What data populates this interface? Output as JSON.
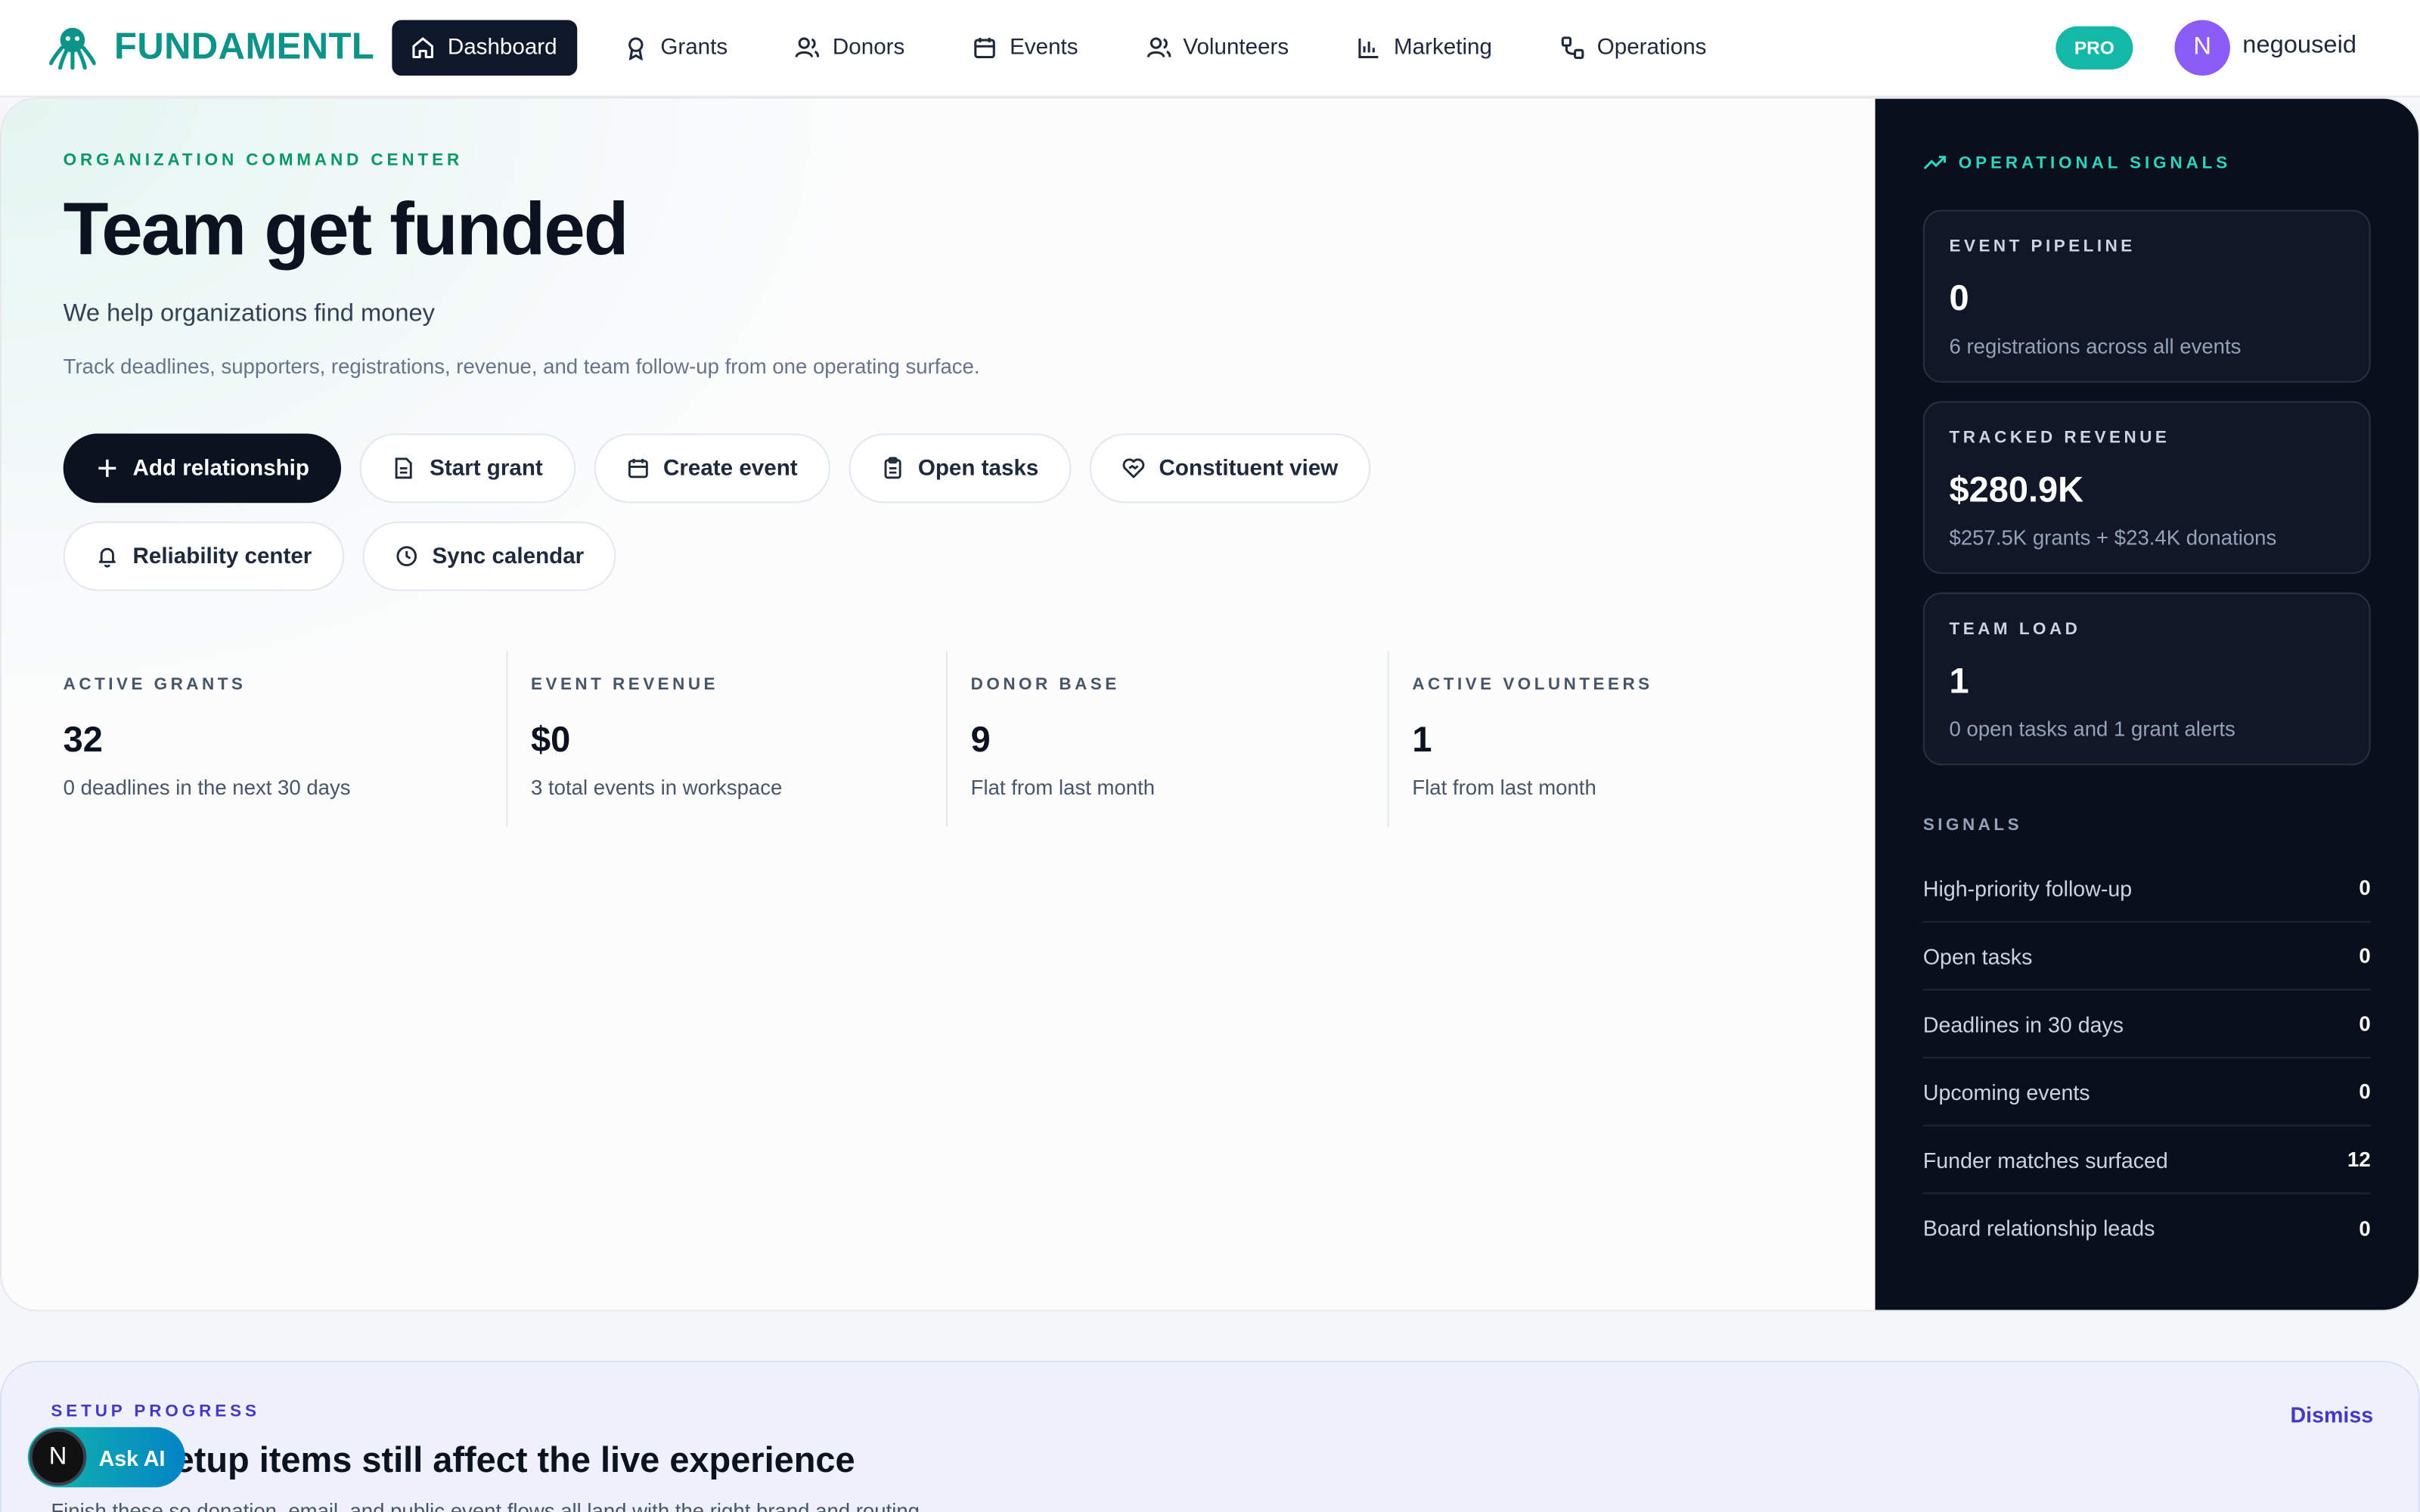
{
  "brand": {
    "name": "FUNDAMENTL",
    "logo_icon": "octopus-icon"
  },
  "nav": {
    "items": [
      {
        "label": "Dashboard",
        "icon": "home-icon",
        "active": true
      },
      {
        "label": "Grants",
        "icon": "award-icon"
      },
      {
        "label": "Donors",
        "icon": "users-icon"
      },
      {
        "label": "Events",
        "icon": "calendar-icon"
      },
      {
        "label": "Volunteers",
        "icon": "users-icon"
      },
      {
        "label": "Marketing",
        "icon": "bar-chart-icon"
      },
      {
        "label": "Operations",
        "icon": "workflow-icon"
      }
    ],
    "plan_badge": "PRO",
    "user": {
      "initial": "N",
      "name": "negouseid"
    }
  },
  "hero": {
    "eyebrow": "ORGANIZATION COMMAND CENTER",
    "title": "Team get funded",
    "subtitle": "We help organizations find money",
    "description": "Track deadlines, supporters, registrations, revenue, and team follow-up from one operating surface.",
    "actions": [
      {
        "label": "Add relationship",
        "icon": "plus-icon",
        "primary": true
      },
      {
        "label": "Start grant",
        "icon": "document-icon"
      },
      {
        "label": "Create event",
        "icon": "calendar-icon"
      },
      {
        "label": "Open tasks",
        "icon": "clipboard-icon"
      },
      {
        "label": "Constituent view",
        "icon": "heart-handshake-icon"
      },
      {
        "label": "Reliability center",
        "icon": "bell-icon"
      },
      {
        "label": "Sync calendar",
        "icon": "clock-icon"
      }
    ]
  },
  "stats": [
    {
      "label": "ACTIVE GRANTS",
      "value": "32",
      "sub": "0 deadlines in the next 30 days"
    },
    {
      "label": "EVENT REVENUE",
      "value": "$0",
      "sub": "3 total events in workspace"
    },
    {
      "label": "DONOR BASE",
      "value": "9",
      "sub": "Flat from last month"
    },
    {
      "label": "ACTIVE VOLUNTEERS",
      "value": "1",
      "sub": "Flat from last month"
    }
  ],
  "signals_panel": {
    "eyebrow": "OPERATIONAL SIGNALS",
    "cards": [
      {
        "label": "EVENT PIPELINE",
        "value": "0",
        "sub": "6 registrations across all events"
      },
      {
        "label": "TRACKED REVENUE",
        "value": "$280.9K",
        "sub": "$257.5K grants + $23.4K donations"
      },
      {
        "label": "TEAM LOAD",
        "value": "1",
        "sub": "0 open tasks and 1 grant alerts"
      }
    ],
    "signals_label": "SIGNALS",
    "signals": [
      {
        "label": "High-priority follow-up",
        "value": "0"
      },
      {
        "label": "Open tasks",
        "value": "0"
      },
      {
        "label": "Deadlines in 30 days",
        "value": "0"
      },
      {
        "label": "Upcoming events",
        "value": "0"
      },
      {
        "label": "Funder matches surfaced",
        "value": "12"
      },
      {
        "label": "Board relationship leads",
        "value": "0"
      }
    ]
  },
  "setup": {
    "eyebrow": "SETUP PROGRESS",
    "title": "etup items still affect the live experience",
    "description": "Finish these so donation, email, and public event flows all land with the right brand and routing.",
    "dismiss": "Dismiss"
  },
  "assistant": {
    "initial": "N",
    "label": "Ask AI"
  },
  "colors": {
    "accent": "#0d9488",
    "dark_panel": "#0a0f1c",
    "setup_accent": "#4338ca"
  }
}
